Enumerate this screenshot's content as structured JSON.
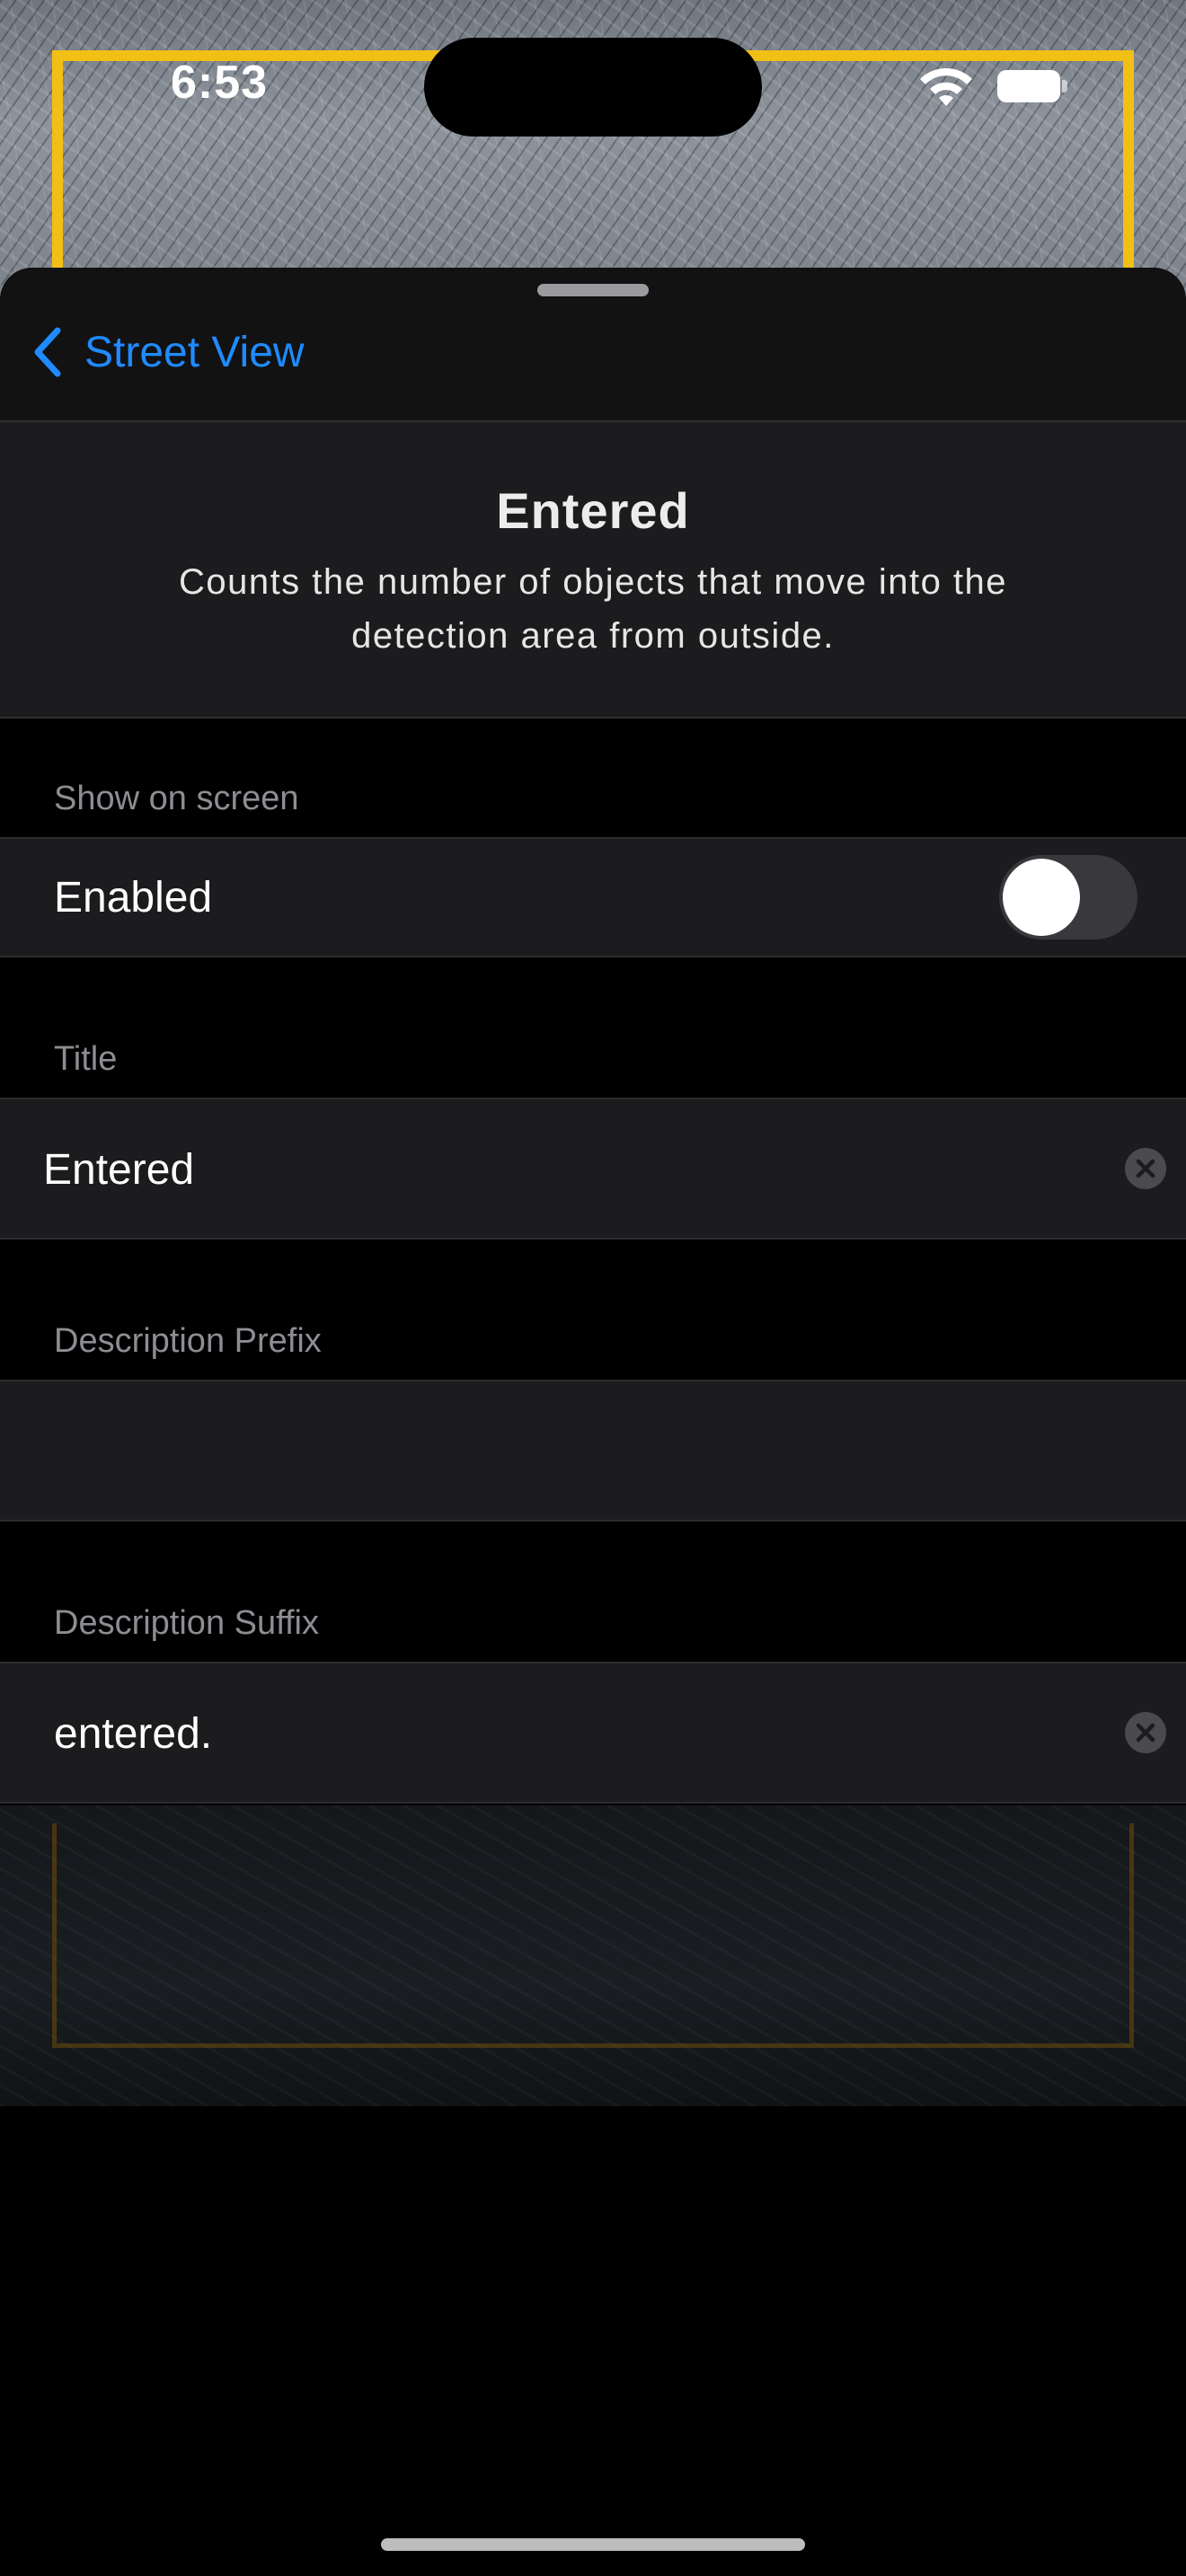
{
  "status_bar": {
    "time": "6:53"
  },
  "nav": {
    "back_label": "Street View"
  },
  "header": {
    "title": "Entered",
    "description": "Counts the number of objects that move into the detection area from outside."
  },
  "sections": {
    "show_on_screen": {
      "label": "Show on screen",
      "row_label": "Enabled",
      "enabled": false
    },
    "title": {
      "label": "Title",
      "value": "Entered"
    },
    "description_prefix": {
      "label": "Description Prefix",
      "value": ""
    },
    "description_suffix": {
      "label": "Description Suffix",
      "value": "entered."
    }
  },
  "colors": {
    "accent": "#1f8bff",
    "detection_frame": "#f2bf14",
    "row_background": "#1c1c1e",
    "toggle_off": "#39393d"
  },
  "icons": [
    "wifi-icon",
    "battery-icon",
    "chevron-left-icon",
    "clear-icon"
  ]
}
